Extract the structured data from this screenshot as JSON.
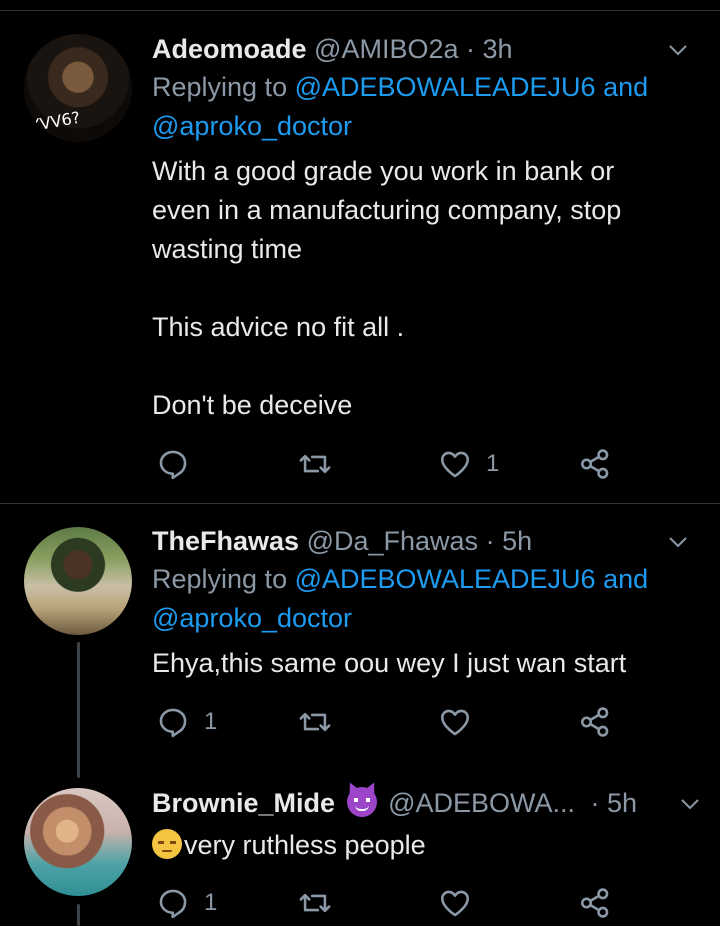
{
  "tweets": [
    {
      "name": "Adeomoade",
      "handle": "@AMIBO2a",
      "dot": "·",
      "time": "3h",
      "replying_prefix": "Replying to ",
      "reply_mention_1": "@ADEBOWALEADEJU6",
      "reply_and": " and",
      "reply_mention_2": "@aproko_doctor",
      "avatar_text": "YVV6?",
      "text": "With a good grade you work in bank or\neven in a manufacturing company, stop\nwasting time\n\nThis advice no fit all .\n\nDon't be deceive",
      "reply_count": "",
      "retweet_count": "",
      "like_count": "1"
    },
    {
      "name": "TheFhawas",
      "handle": "@Da_Fhawas",
      "dot": "·",
      "time": "5h",
      "replying_prefix": "Replying to ",
      "reply_mention_1": "@ADEBOWALEADEJU6",
      "reply_and": " and",
      "reply_mention_2": "@aproko_doctor",
      "text": "Ehya,this same oou wey I just wan start",
      "reply_count": "1",
      "retweet_count": "",
      "like_count": ""
    },
    {
      "name": "Brownie_Mide",
      "handle": "@ADEBOWA...",
      "dot": "·",
      "time": "5h",
      "text": "very ruthless people",
      "reply_count": "1",
      "retweet_count": "",
      "like_count": ""
    }
  ],
  "icons": {
    "reply": "reply-icon",
    "retweet": "retweet-icon",
    "like": "heart-icon",
    "share": "share-icon",
    "caret": "chevron-down-icon"
  },
  "colors": {
    "background": "#000000",
    "text": "#e7e9ea",
    "muted": "#8b98a5",
    "mention": "#1d9bf0",
    "divider": "#2f3336"
  }
}
